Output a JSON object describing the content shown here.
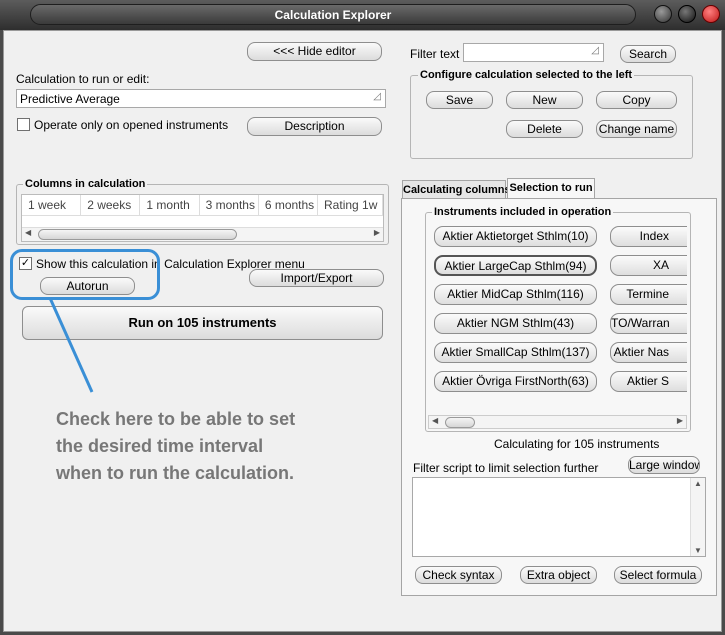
{
  "window": {
    "title": "Calculation Explorer"
  },
  "left": {
    "hide_editor": "<<< Hide editor",
    "calc_label": "Calculation to run or edit:",
    "calc_value": "Predictive Average",
    "operate_only": "Operate only on opened instruments",
    "description": "Description",
    "columns_title": "Columns in calculation",
    "columns": [
      "1 week",
      "2 weeks",
      "1 month",
      "3 months",
      "6 months",
      "Rating 1w"
    ],
    "show_in_menu": "Show this calculation in Calculation Explorer menu",
    "autorun": "Autorun",
    "import_export": "Import/Export",
    "run_button": "Run on 105 instruments"
  },
  "annotation": {
    "lines": [
      "Check here to be able to set",
      "the desired time interval",
      "when to run the calculation."
    ]
  },
  "right": {
    "filter_text_label": "Filter text",
    "search": "Search",
    "configure_title": "Configure calculation selected to the left",
    "save": "Save",
    "new": "New",
    "copy": "Copy",
    "delete": "Delete",
    "change_name": "Change name",
    "tab_columns": "Calculating columns",
    "tab_selection": "Selection to run",
    "instruments_title": "Instruments included in operation",
    "instruments_left": [
      "Aktier Aktietorget Sthlm(10)",
      "Aktier LargeCap Sthlm(94)",
      "Aktier MidCap Sthlm(116)",
      "Aktier NGM Sthlm(43)",
      "Aktier SmallCap Sthlm(137)",
      "Aktier Övriga FirstNorth(63)"
    ],
    "instruments_right": [
      "Index",
      "XA",
      "Termine",
      "TO/Warran",
      "Aktier Nas",
      "Aktier S"
    ],
    "calculating_for": "Calculating for 105 instruments",
    "filter_script_label": "Filter script to limit selection further",
    "large_window": "Large window",
    "check_syntax": "Check syntax",
    "extra_object": "Extra object",
    "select_formula": "Select formula"
  },
  "colors": {
    "annotation_blue": "#3a8fd6",
    "annotation_text": "#777777",
    "close_red": "#d93030"
  }
}
